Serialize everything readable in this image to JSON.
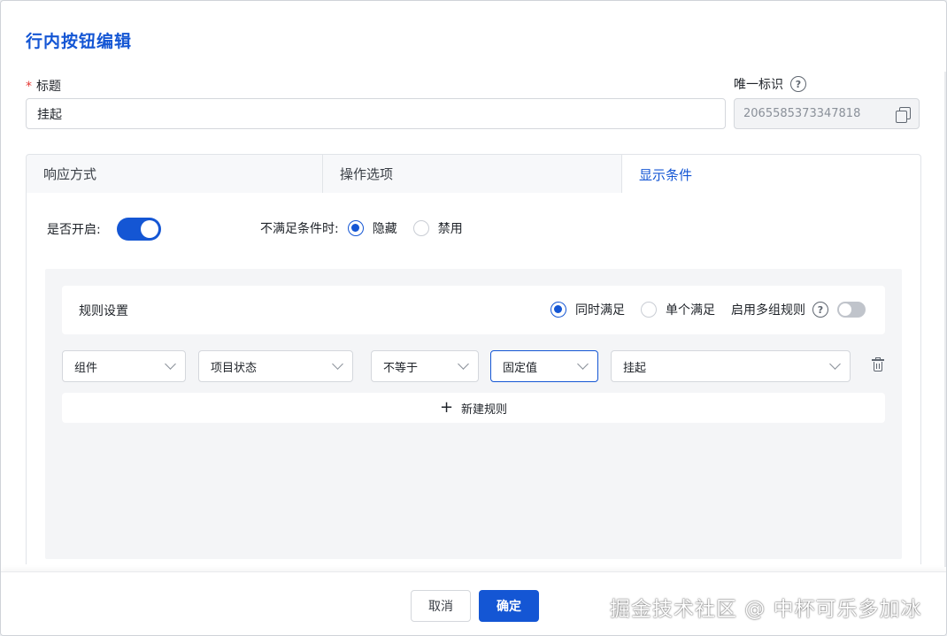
{
  "dialog": {
    "title": "行内按钮编辑",
    "fields": {
      "title_label": "标题",
      "title_required_mark": "*",
      "title_value": "挂起",
      "id_label": "唯一标识",
      "id_value": "2065585373347818"
    },
    "tabs": [
      {
        "label": "响应方式",
        "active": false
      },
      {
        "label": "操作选项",
        "active": false
      },
      {
        "label": "显示条件",
        "active": true
      }
    ],
    "condition": {
      "enable_label": "是否开启:",
      "enabled": true,
      "unmet_label": "不满足条件时:",
      "unmet_options": [
        {
          "label": "隐藏",
          "selected": true
        },
        {
          "label": "禁用",
          "selected": false
        }
      ]
    },
    "rules": {
      "title": "规则设置",
      "match_options": [
        {
          "label": "同时满足",
          "selected": true
        },
        {
          "label": "单个满足",
          "selected": false
        }
      ],
      "multi_group_label": "启用多组规则",
      "multi_group_enabled": false,
      "rows": [
        {
          "component": "组件",
          "field": "项目状态",
          "operator": "不等于",
          "value_type": "固定值",
          "value": "挂起"
        }
      ],
      "add_rule_label": "新建规则"
    },
    "footer": {
      "cancel_label": "取消",
      "ok_label": "确定"
    },
    "watermark": "掘金技术社区 @ 中杯可乐多加冰"
  },
  "colors": {
    "primary": "#1456d4",
    "required": "#e53935"
  },
  "icons": [
    "help-icon",
    "copy-icon",
    "chevron-down-icon",
    "trash-icon",
    "plus-icon"
  ]
}
